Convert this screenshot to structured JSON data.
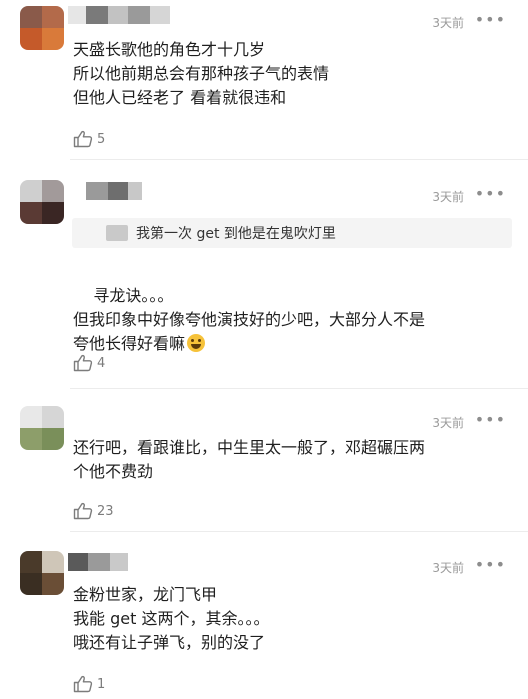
{
  "comments": [
    {
      "time": "3天前",
      "more": "•••",
      "lines": "天盛长歌他的角色才十几岁\n所以他前期总会有那种孩子气的表情\n但他人已经老了 看着就很违和",
      "likes": "5"
    },
    {
      "time": "3天前",
      "more": "•••",
      "quote": "我第一次 get 到他是在鬼吹灯里",
      "lines": "寻龙诀。。。\n但我印象中好像夸他演技好的少吧，大部分人不是\n夸他长得好看嘛",
      "emoji": "laughing-tears-emoji",
      "likes": "4"
    },
    {
      "time": "3天前",
      "more": "•••",
      "lines": "还行吧，看跟谁比，中生里太一般了，邓超碾压两\n个他不费劲",
      "likes": "23"
    },
    {
      "time": "3天前",
      "more": "•••",
      "lines": "金粉世家，龙门飞甲\n我能 get 这两个，其余。。。\n哦还有让子弹飞，别的没了",
      "likes": "1"
    }
  ],
  "icons": {
    "like": "thumbs-up-icon",
    "more": "more-dots-icon"
  },
  "colors": {
    "text": "#1f1f1f",
    "meta": "#9a9a9a",
    "quote_bg": "#f4f4f4",
    "divider": "#ececec"
  }
}
